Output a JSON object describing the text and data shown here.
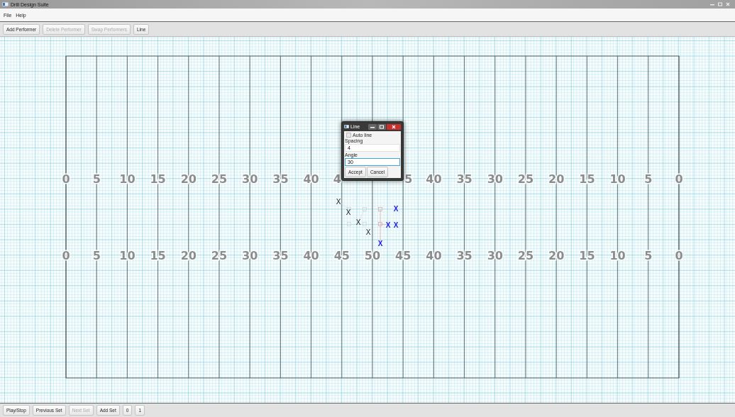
{
  "window": {
    "title": "Drill Design Suite"
  },
  "menu": [
    "File",
    "Help"
  ],
  "toolbar": [
    {
      "label": "Add Performer",
      "disabled": false
    },
    {
      "label": "Delete Performer",
      "disabled": true
    },
    {
      "label": "Swap Performers",
      "disabled": true
    },
    {
      "label": "Line",
      "disabled": false
    }
  ],
  "field": {
    "yard_lines": [
      {
        "top": {
          "text": "0"
        },
        "bottom": {
          "text": "0"
        }
      },
      {
        "top": {
          "text": "5"
        },
        "bottom": {
          "text": "5"
        }
      },
      {
        "top": {
          "text": "10"
        },
        "bottom": {
          "text": "10"
        }
      },
      {
        "top": {
          "text": "15"
        },
        "bottom": {
          "text": "15"
        }
      },
      {
        "top": {
          "text": "20"
        },
        "bottom": {
          "text": "20"
        }
      },
      {
        "top": {
          "text": "25"
        },
        "bottom": {
          "text": "25"
        }
      },
      {
        "top": {
          "text": "30"
        },
        "bottom": {
          "text": "30"
        }
      },
      {
        "top": {
          "text": "35"
        },
        "bottom": {
          "text": "35"
        }
      },
      {
        "top": {
          "text": "40"
        },
        "bottom": {
          "text": "40"
        }
      },
      {
        "top": {
          "text": "4"
        },
        "bottom": {
          "text": "45"
        }
      },
      {
        "bottom": {
          "text": "50"
        }
      },
      {
        "top": {
          "text": "5"
        },
        "bottom": {
          "text": "45"
        }
      },
      {
        "top": {
          "text": "40"
        },
        "bottom": {
          "text": "40"
        }
      },
      {
        "top": {
          "text": "35"
        },
        "bottom": {
          "text": "35"
        }
      },
      {
        "top": {
          "text": "30"
        },
        "bottom": {
          "text": "30"
        }
      },
      {
        "top": {
          "text": "25"
        },
        "bottom": {
          "text": "25"
        }
      },
      {
        "top": {
          "text": "20"
        },
        "bottom": {
          "text": "20"
        }
      },
      {
        "top": {
          "text": "15"
        },
        "bottom": {
          "text": "15"
        }
      },
      {
        "top": {
          "text": "10"
        },
        "bottom": {
          "text": "10"
        }
      },
      {
        "top": {
          "text": "5"
        },
        "bottom": {
          "text": "5"
        }
      },
      {
        "top": {
          "text": "0"
        },
        "bottom": {
          "text": "0"
        }
      }
    ]
  },
  "performers": [
    {
      "symbol": "X",
      "selected": false
    },
    {
      "symbol": "X",
      "selected": false
    },
    {
      "symbol": "X",
      "selected": false
    },
    {
      "symbol": "X",
      "selected": false
    },
    {
      "symbol": "X",
      "selected": true
    },
    {
      "symbol": "X",
      "selected": true
    },
    {
      "symbol": "X",
      "selected": true
    },
    {
      "symbol": "X",
      "selected": true
    }
  ],
  "dialog": {
    "title": "Line",
    "auto_line": {
      "label": "Auto line",
      "checked": false
    },
    "spacing": {
      "label": "Spacing",
      "value": "4",
      "focused": false
    },
    "angle": {
      "label": "Angle",
      "value": "30",
      "focused": true
    },
    "buttons": [
      "Accept",
      "Cancel"
    ]
  },
  "bottom_bar": [
    {
      "label": "Play/Stop",
      "disabled": false
    },
    {
      "label": "Previous Set",
      "disabled": false
    },
    {
      "label": "Next Set",
      "disabled": true
    },
    {
      "label": "Add Set",
      "disabled": false
    },
    {
      "label": "0",
      "disabled": false
    },
    {
      "label": "1",
      "disabled": false
    }
  ]
}
